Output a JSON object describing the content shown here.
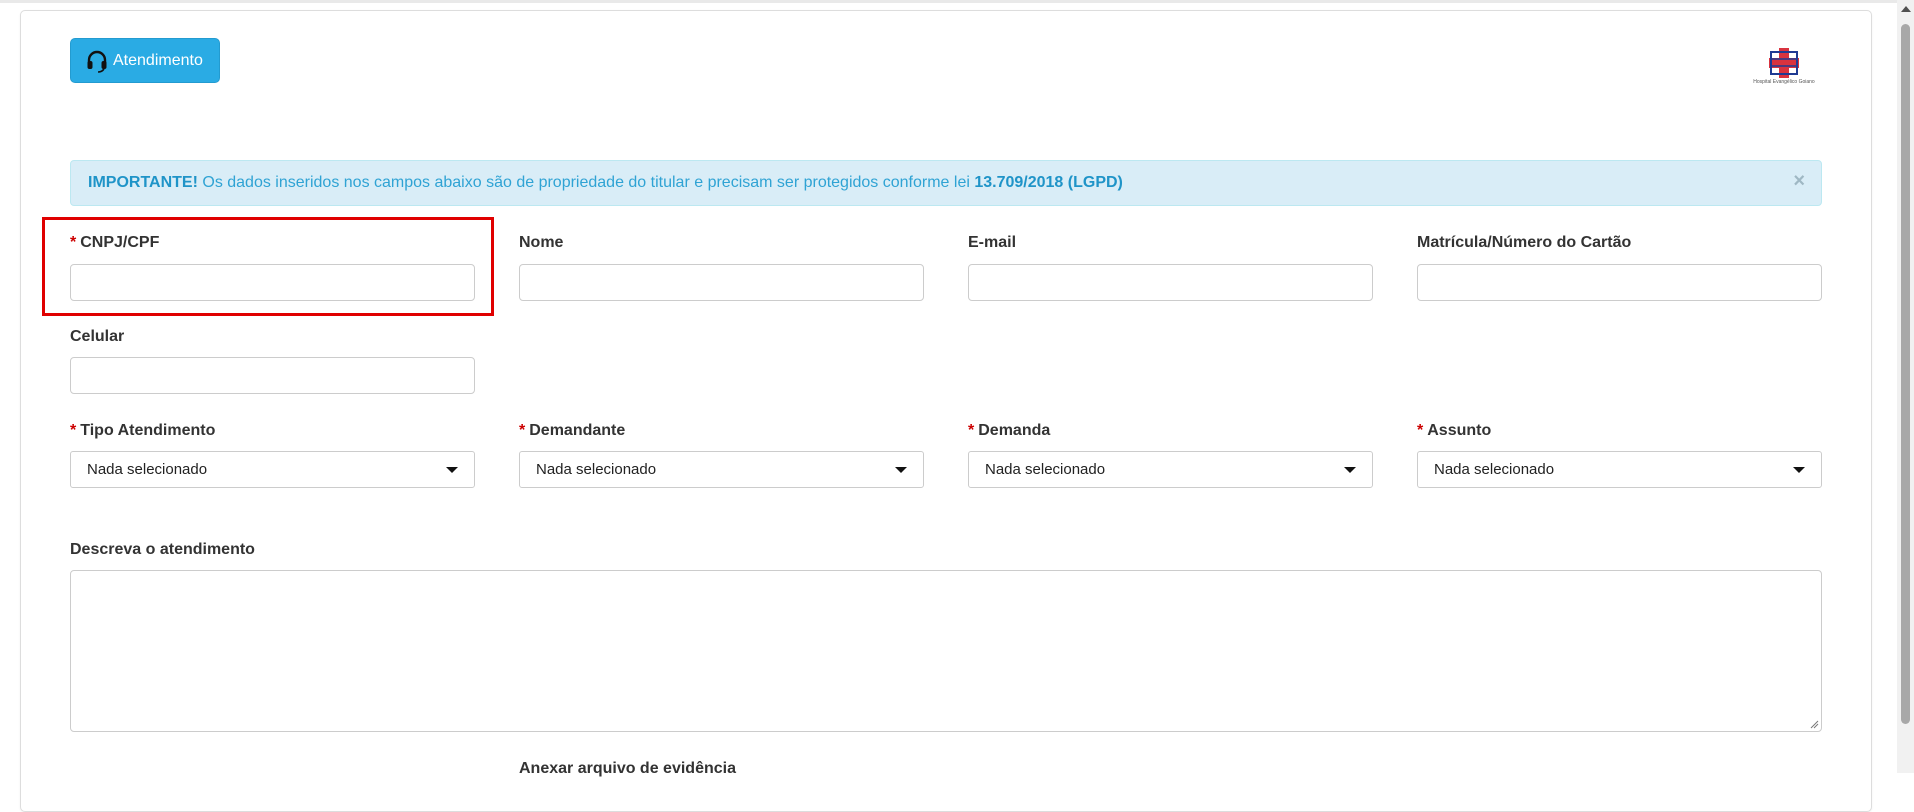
{
  "header": {
    "atendimento_button": "Atendimento",
    "logo_text": "Hospital Evangélico Goiano"
  },
  "alert": {
    "strong_label": "IMPORTANTE!",
    "message": " Os dados inseridos nos campos abaixo são de propriedade do titular e precisam ser protegidos conforme lei ",
    "law": "13.709/2018 (LGPD)",
    "close": "×"
  },
  "fields": {
    "required_mark": "*",
    "cnpj_cpf": "CNPJ/CPF",
    "nome": "Nome",
    "email": "E-mail",
    "matricula": "Matrícula/Número do Cartão",
    "celular": "Celular",
    "tipo_atendimento": "Tipo Atendimento",
    "demandante": "Demandante",
    "demanda": "Demanda",
    "assunto": "Assunto",
    "descreva": "Descreva o atendimento",
    "anexar": "Anexar arquivo de evidência"
  },
  "selects": {
    "tipo_atendimento": "Nada selecionado",
    "demandante": "Nada selecionado",
    "demanda": "Nada selecionado",
    "assunto": "Nada selecionado"
  },
  "colors": {
    "button": "#2aabe4",
    "alert_bg": "#d9edf7",
    "alert_text": "#2fa3d4",
    "required": "#cc0000",
    "highlight": "#e00000"
  },
  "icons": [
    "headset-icon",
    "close-icon",
    "caret-down-icon",
    "resize-grip-icon",
    "hospital-logo"
  ]
}
